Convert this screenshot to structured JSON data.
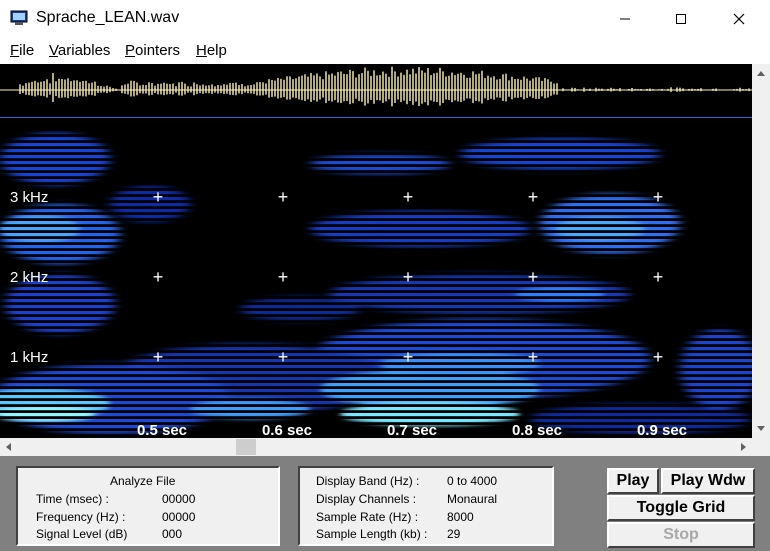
{
  "window": {
    "title": "Sprache_LEAN.wav",
    "controls": {
      "minimize": "minimize-icon",
      "maximize": "maximize-icon",
      "close": "close-icon"
    }
  },
  "menu": [
    {
      "label": "File",
      "accel": "F",
      "rest": "ile"
    },
    {
      "label": "Variables",
      "accel": "V",
      "rest": "ariables"
    },
    {
      "label": "Pointers",
      "accel": "P",
      "rest": "ointers"
    },
    {
      "label": "Help",
      "accel": "H",
      "rest": "elp"
    }
  ],
  "spectrogram": {
    "freq_labels": [
      "3  kHz",
      "2  kHz",
      "1  kHz"
    ],
    "time_labels": [
      "0.5 sec",
      "0.6 sec",
      "0.7 sec",
      "0.8 sec",
      "0.9 sec"
    ],
    "grid_marker": "+",
    "colors": {
      "background": "#000000",
      "energy_low": "#1030c0",
      "energy_mid": "#2a7fff",
      "energy_high": "#7ff5ff",
      "waveform": "#fff3b0"
    }
  },
  "analyze_panel": {
    "title": "Analyze File",
    "rows": [
      {
        "label": "Time (msec) :",
        "value": "00000"
      },
      {
        "label": "Frequency (Hz) :",
        "value": "00000"
      },
      {
        "label": "Signal Level (dB)",
        "value": "000"
      }
    ]
  },
  "display_panel": {
    "rows": [
      {
        "label": "Display Band (Hz) :",
        "value": "0 to 4000"
      },
      {
        "label": "Display Channels :",
        "value": "Monaural"
      },
      {
        "label": "Sample Rate (Hz) :",
        "value": "8000"
      },
      {
        "label": "Sample Length (kb) :",
        "value": "29"
      }
    ]
  },
  "buttons": {
    "play": "Play",
    "play_window": "Play Wdw",
    "toggle_grid": "Toggle Grid",
    "stop": "Stop"
  },
  "scrollbars": {
    "up": "▲",
    "down": "▼",
    "left": "◄",
    "right": "►"
  }
}
